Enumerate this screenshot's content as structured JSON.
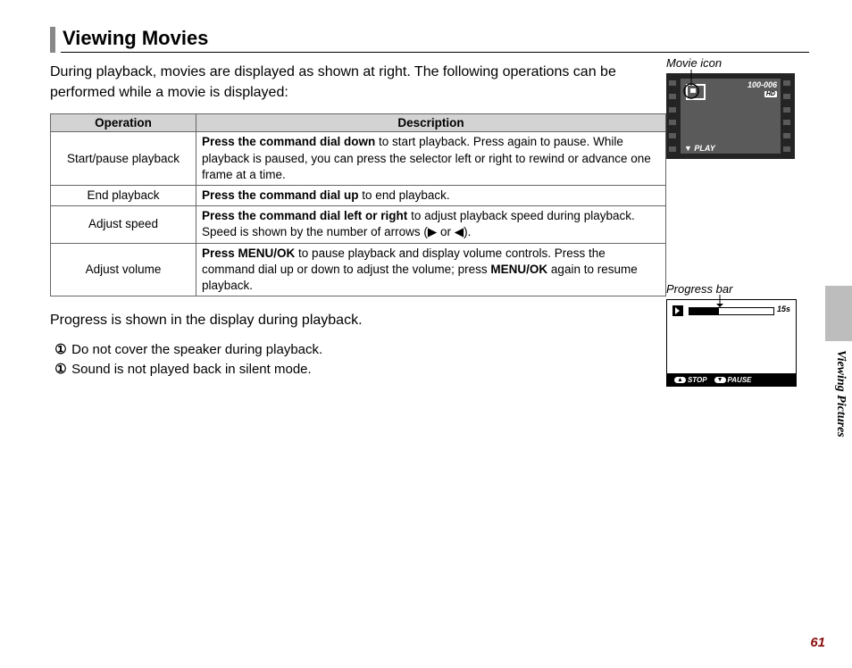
{
  "heading": "Viewing Movies",
  "intro": "During playback, movies are displayed as shown at right. The following operations can be performed while a movie is displayed:",
  "table": {
    "headers": {
      "op": "Operation",
      "desc": "Description"
    },
    "rows": [
      {
        "op": "Start/pause playback",
        "bold": "Press the command dial down",
        "rest": " to start playback.  Press again to pause. While playback is paused, you can press the selector left or right to rewind or advance one frame at a time."
      },
      {
        "op": "End playback",
        "bold": "Press the command dial up",
        "rest": " to end playback."
      },
      {
        "op": "Adjust speed",
        "bold": "Press the command dial left or right",
        "rest": " to adjust playback speed during playback. Speed is shown by the number of arrows (▶ or ◀)."
      },
      {
        "op": "Adjust volume",
        "bold": "Press MENU/OK",
        "mid": " to pause playback and display volume controls.  Press the command dial up or down to adjust the volume; press ",
        "bold2": "MENU/OK",
        "rest": " again to resume playback."
      }
    ]
  },
  "progress_line": "Progress is shown in the display during playback.",
  "notes": [
    "Do not cover the speaker during playback.",
    "Sound is not played back in silent mode."
  ],
  "note_glyph": "①",
  "callouts": {
    "movie_icon": "Movie icon",
    "progress_bar": "Progress bar"
  },
  "lcd1": {
    "counter": "100-006",
    "hd": "HD",
    "play": "▼ PLAY"
  },
  "lcd2": {
    "time": "15s",
    "stop": "STOP",
    "pause": "PAUSE"
  },
  "side_section": "Viewing Pictures",
  "page_number": "61"
}
